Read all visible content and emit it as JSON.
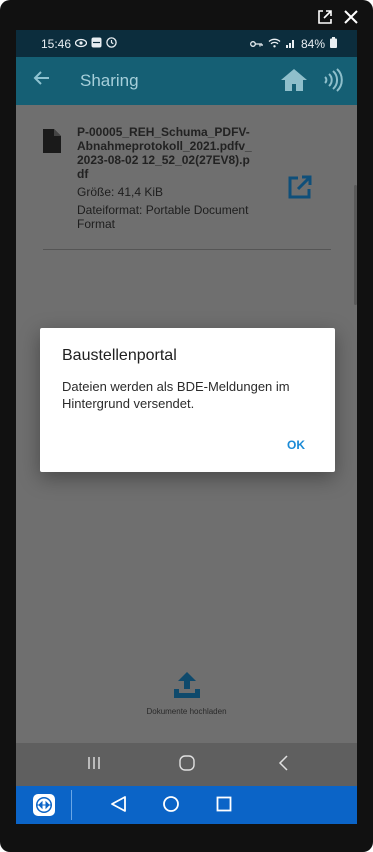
{
  "window": {
    "external_icon": "external-link-icon",
    "close_icon": "close-icon"
  },
  "status_bar": {
    "time": "15:46",
    "battery": "84%",
    "icons": [
      "eye-icon",
      "teamviewer-icon",
      "clock-icon",
      "key-icon",
      "wifi-icon",
      "signal-icon",
      "battery-icon"
    ]
  },
  "app_bar": {
    "title": "Sharing",
    "back_icon": "back-arrow-icon",
    "home_icon": "home-icon",
    "nfc_icon": "nfc-icon"
  },
  "file": {
    "name": "P-00005_REH_Schuma_PDFV-Abnahmeprotokoll_2021.pdfv_2023-08-02 12_52_02(27EV8).pdf",
    "size": "Größe: 41,4 KiB",
    "format": "Dateiformat: Portable Document Format",
    "icon": "file-icon",
    "share_icon": "open-external-icon"
  },
  "upload": {
    "label": "Dokumente hochladen",
    "icon": "upload-icon"
  },
  "dialog": {
    "title": "Baustellenportal",
    "message": "Dateien werden als BDE-Meldungen im Hintergrund versendet.",
    "ok_label": "OK"
  },
  "android_nav": {
    "recents_icon": "recents-icon",
    "home_icon": "home-circle-icon",
    "back_icon": "back-chevron-icon"
  },
  "teamviewer_bar": {
    "logo_icon": "teamviewer-logo-icon",
    "back_icon": "triangle-back-icon",
    "home_icon": "circle-home-icon",
    "recents_icon": "square-recents-icon"
  },
  "colors": {
    "appbar": "#155f74",
    "statusbar": "#0c2d3d",
    "accent": "#1a8ad6",
    "teamviewer": "#0b64c7",
    "overlay": "#6f6f6f"
  }
}
